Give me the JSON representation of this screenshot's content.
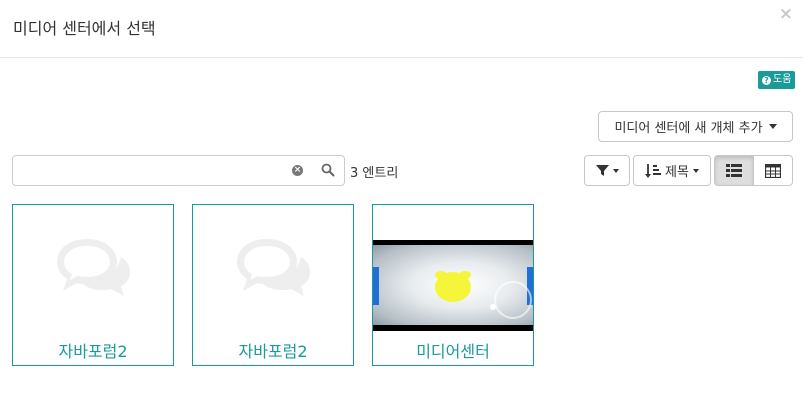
{
  "dialog": {
    "title": "미디어 센터에서 선택",
    "close_glyph": "×"
  },
  "help": {
    "icon_glyph": "?",
    "label": "도움"
  },
  "toolbar": {
    "add_button_label": "미디어 센터에 새 개체 추가",
    "search_value": "",
    "entry_count": "3 엔트리",
    "sort_label": "제목"
  },
  "items": [
    {
      "label": "자바포럼2",
      "thumb": "chat-bubbles-icon"
    },
    {
      "label": "자바포럼2",
      "thumb": "chat-bubbles-icon"
    },
    {
      "label": "미디어센터",
      "thumb": "video-thumbnail"
    }
  ],
  "colors": {
    "accent": "#1a9a99",
    "placeholder_icon": "#eeeeee"
  }
}
